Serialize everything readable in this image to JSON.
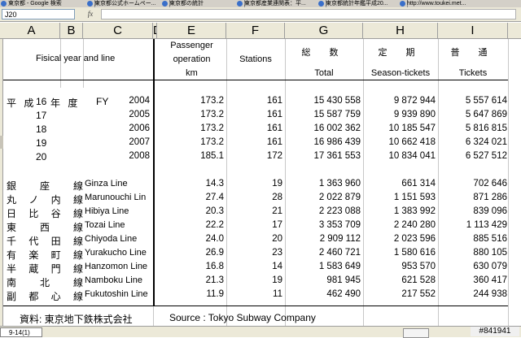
{
  "tabs": [
    {
      "label": "東京都 - Google 検索"
    },
    {
      "label": "東京都公式ホームペー..."
    },
    {
      "label": "東京都の統計"
    },
    {
      "label": "東京都産業連関表：平..."
    },
    {
      "label": "東京都統計年鑑平成20..."
    },
    {
      "label": "http://www.toukei.met..."
    }
  ],
  "formula_bar": {
    "cell_ref": "J20",
    "fx": "fx",
    "content": ""
  },
  "columns": [
    "A",
    "B",
    "C",
    "D",
    "E",
    "F",
    "G",
    "H",
    "I"
  ],
  "header": {
    "left_label": "Fisical year and line",
    "E": {
      "line1": "Passenger",
      "line2": "operation",
      "unit": "km"
    },
    "F": {
      "label": "Stations"
    },
    "G": {
      "jp": "総 数",
      "en": "Total"
    },
    "H": {
      "jp": "定 期",
      "en": "Season-tickets"
    },
    "I": {
      "jp": "普 通",
      "en": "Tickets"
    }
  },
  "years": {
    "era": "平 成",
    "era_suffix": "年 度",
    "fy_label": "FY",
    "rows": [
      {
        "heisei": "16",
        "year": "2004",
        "km": "173.2",
        "stations": "161",
        "total": "15 430 558",
        "season": "9 872 944",
        "tickets": "5 557 614"
      },
      {
        "heisei": "17",
        "year": "2005",
        "km": "173.2",
        "stations": "161",
        "total": "15 587 759",
        "season": "9 939 890",
        "tickets": "5 647 869"
      },
      {
        "heisei": "18",
        "year": "2006",
        "km": "173.2",
        "stations": "161",
        "total": "16 002 362",
        "season": "10 185 547",
        "tickets": "5 816 815"
      },
      {
        "heisei": "19",
        "year": "2007",
        "km": "173.2",
        "stations": "161",
        "total": "16 986 439",
        "season": "10 662 418",
        "tickets": "6 324 021"
      },
      {
        "heisei": "20",
        "year": "2008",
        "km": "185.1",
        "stations": "172",
        "total": "17 361 553",
        "season": "10 834 041",
        "tickets": "6 527 512"
      }
    ]
  },
  "lines": [
    {
      "jp": "銀 座 線",
      "en": "Ginza Line",
      "km": "14.3",
      "stations": "19",
      "total": "1 363 960",
      "season": "661 314",
      "tickets": "702 646"
    },
    {
      "jp": "丸 ノ 内 線",
      "en": "Marunouchi Lin",
      "km": "27.4",
      "stations": "28",
      "total": "2 022 879",
      "season": "1 151 593",
      "tickets": "871 286"
    },
    {
      "jp": "日 比 谷 線",
      "en": "Hibiya Line",
      "km": "20.3",
      "stations": "21",
      "total": "2 223 088",
      "season": "1 383 992",
      "tickets": "839 096"
    },
    {
      "jp": "東 西 線",
      "en": "Tozai Line",
      "km": "22.2",
      "stations": "17",
      "total": "3 353 709",
      "season": "2 240 280",
      "tickets": "1 113 429"
    },
    {
      "jp": "千 代 田 線",
      "en": "Chiyoda Line",
      "km": "24.0",
      "stations": "20",
      "total": "2 909 112",
      "season": "2 023 596",
      "tickets": "885 516"
    },
    {
      "jp": "有 楽 町 線",
      "en": "Yurakucho Line",
      "km": "26.9",
      "stations": "23",
      "total": "2 460 721",
      "season": "1 580 616",
      "tickets": "880 105"
    },
    {
      "jp": "半 蔵 門 線",
      "en": "Hanzomon Line",
      "km": "16.8",
      "stations": "14",
      "total": "1 583 649",
      "season": "953 570",
      "tickets": "630 079"
    },
    {
      "jp": "南 北 線",
      "en": "Namboku Line",
      "km": "21.3",
      "stations": "19",
      "total": "981 945",
      "season": "621 528",
      "tickets": "360 417"
    },
    {
      "jp": "副 都 心 線",
      "en": "Fukutoshin Line",
      "km": "11.9",
      "stations": "11",
      "total": "462 490",
      "season": "217 552",
      "tickets": "244 938"
    }
  ],
  "footer": {
    "source_jp": "資料: 東京地下鉄株式会社",
    "source_en": "Source : Tokyo Subway Company"
  },
  "sheet_tab": "9-14(1)",
  "badge": "#841941"
}
